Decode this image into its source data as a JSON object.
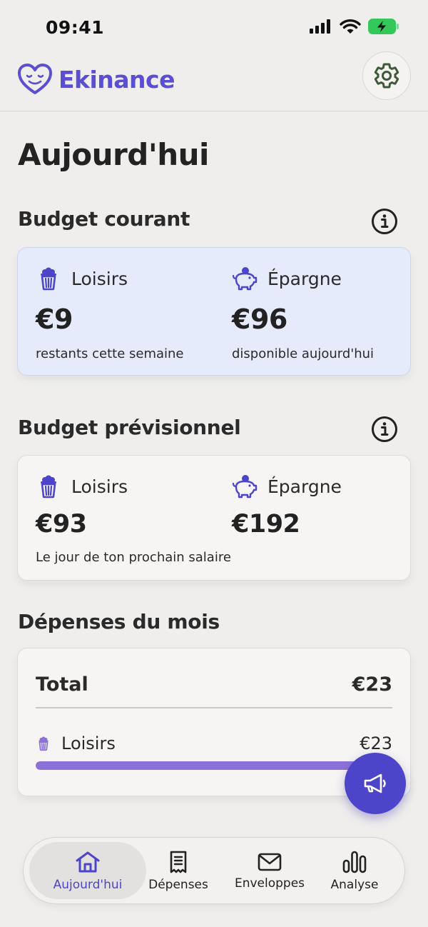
{
  "status_bar": {
    "time": "09:41"
  },
  "header": {
    "app_name": "Ekinance"
  },
  "page": {
    "title": "Aujourd'hui"
  },
  "current_budget": {
    "title": "Budget courant",
    "leisure": {
      "label": "Loisirs",
      "amount": "€9",
      "caption": "restants cette semaine"
    },
    "savings": {
      "label": "Épargne",
      "amount": "€96",
      "caption": "disponible aujourd'hui"
    }
  },
  "forecast_budget": {
    "title": "Budget prévisionnel",
    "leisure": {
      "label": "Loisirs",
      "amount": "€93"
    },
    "savings": {
      "label": "Épargne",
      "amount": "€192"
    },
    "caption": "Le jour de ton prochain salaire"
  },
  "monthly_spending": {
    "title": "Dépenses du mois",
    "total_label": "Total",
    "total_value": "€23",
    "categories": [
      {
        "label": "Loisirs",
        "value": "€23",
        "progress": 1.0
      }
    ]
  },
  "tabs": [
    {
      "label": "Aujourd'hui",
      "icon": "home-icon",
      "active": true
    },
    {
      "label": "Dépenses",
      "icon": "receipt-icon",
      "active": false
    },
    {
      "label": "Enveloppes",
      "icon": "envelope-icon",
      "active": false
    },
    {
      "label": "Analyse",
      "icon": "bar-chart-icon",
      "active": false
    }
  ],
  "colors": {
    "accent": "#4c45c9",
    "brand": "#5a4fd1",
    "progress": "#8b72d6",
    "card_highlight": "#e6ebfc",
    "battery": "#34c759"
  }
}
